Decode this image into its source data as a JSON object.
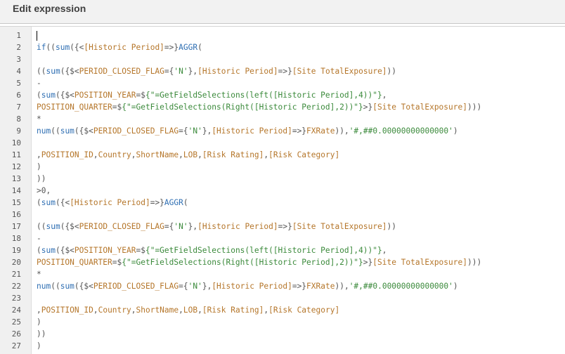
{
  "dialog": {
    "title": "Edit expression"
  },
  "editor": {
    "lines": [
      {
        "n": "1",
        "tokens": []
      },
      {
        "n": "2",
        "tokens": [
          [
            "k",
            "if"
          ],
          [
            "p",
            "(("
          ],
          [
            "k",
            "sum"
          ],
          [
            "p",
            "({<"
          ],
          [
            "f",
            "[Historic Period]"
          ],
          [
            "p",
            "=>}"
          ],
          [
            "k",
            "AGGR"
          ],
          [
            "p",
            "("
          ]
        ]
      },
      {
        "n": "3",
        "tokens": []
      },
      {
        "n": "4",
        "tokens": [
          [
            "p",
            "(("
          ],
          [
            "k",
            "sum"
          ],
          [
            "p",
            "({$<"
          ],
          [
            "f",
            "PERIOD_CLOSED_FLAG"
          ],
          [
            "p",
            "={"
          ],
          [
            "s",
            "'N'"
          ],
          [
            "p",
            "},"
          ],
          [
            "f",
            "[Historic Period]"
          ],
          [
            "p",
            "=>}"
          ],
          [
            "f",
            "[Site TotalExposure]"
          ],
          [
            "p",
            "))"
          ]
        ]
      },
      {
        "n": "5",
        "tokens": [
          [
            "p",
            "-"
          ]
        ]
      },
      {
        "n": "6",
        "tokens": [
          [
            "p",
            "("
          ],
          [
            "k",
            "sum"
          ],
          [
            "p",
            "({$<"
          ],
          [
            "f",
            "POSITION_YEAR"
          ],
          [
            "p",
            "=$"
          ],
          [
            "s",
            "{\"=GetFieldSelections(left([Historic Period],4))\"}"
          ],
          [
            "p",
            ","
          ]
        ]
      },
      {
        "n": "7",
        "tokens": [
          [
            "f",
            "POSITION_QUARTER"
          ],
          [
            "p",
            "=$"
          ],
          [
            "s",
            "{\"=GetFieldSelections(Right([Historic Period],2))\"}"
          ],
          [
            "p",
            ">}"
          ],
          [
            "f",
            "[Site TotalExposure]"
          ],
          [
            "p",
            ")))"
          ]
        ]
      },
      {
        "n": "8",
        "tokens": [
          [
            "p",
            "*"
          ]
        ]
      },
      {
        "n": "9",
        "tokens": [
          [
            "k",
            "num"
          ],
          [
            "p",
            "(("
          ],
          [
            "k",
            "sum"
          ],
          [
            "p",
            "({$<"
          ],
          [
            "f",
            "PERIOD_CLOSED_FLAG"
          ],
          [
            "p",
            "={"
          ],
          [
            "s",
            "'N'"
          ],
          [
            "p",
            "},"
          ],
          [
            "f",
            "[Historic Period]"
          ],
          [
            "p",
            "=>}"
          ],
          [
            "f",
            "FXRate"
          ],
          [
            "p",
            ")),"
          ],
          [
            "s",
            "'#,##0.00000000000000'"
          ],
          [
            "p",
            ")"
          ]
        ]
      },
      {
        "n": "10",
        "tokens": []
      },
      {
        "n": "11",
        "tokens": [
          [
            "p",
            ","
          ],
          [
            "f",
            "POSITION_ID"
          ],
          [
            "p",
            ","
          ],
          [
            "f",
            "Country"
          ],
          [
            "p",
            ","
          ],
          [
            "f",
            "ShortName"
          ],
          [
            "p",
            ","
          ],
          [
            "f",
            "LOB"
          ],
          [
            "p",
            ","
          ],
          [
            "f",
            "[Risk Rating]"
          ],
          [
            "p",
            ","
          ],
          [
            "f",
            "[Risk Category]"
          ]
        ]
      },
      {
        "n": "12",
        "tokens": [
          [
            "p",
            ")"
          ]
        ]
      },
      {
        "n": "13",
        "tokens": [
          [
            "p",
            "))"
          ]
        ]
      },
      {
        "n": "14",
        "tokens": [
          [
            "p",
            ">0,"
          ]
        ]
      },
      {
        "n": "15",
        "tokens": [
          [
            "p",
            "("
          ],
          [
            "k",
            "sum"
          ],
          [
            "p",
            "({<"
          ],
          [
            "f",
            "[Historic Period]"
          ],
          [
            "p",
            "=>}"
          ],
          [
            "k",
            "AGGR"
          ],
          [
            "p",
            "("
          ]
        ]
      },
      {
        "n": "16",
        "tokens": []
      },
      {
        "n": "17",
        "tokens": [
          [
            "p",
            "(("
          ],
          [
            "k",
            "sum"
          ],
          [
            "p",
            "({$<"
          ],
          [
            "f",
            "PERIOD_CLOSED_FLAG"
          ],
          [
            "p",
            "={"
          ],
          [
            "s",
            "'N'"
          ],
          [
            "p",
            "},"
          ],
          [
            "f",
            "[Historic Period]"
          ],
          [
            "p",
            "=>}"
          ],
          [
            "f",
            "[Site TotalExposure]"
          ],
          [
            "p",
            "))"
          ]
        ]
      },
      {
        "n": "18",
        "tokens": [
          [
            "p",
            "-"
          ]
        ]
      },
      {
        "n": "19",
        "tokens": [
          [
            "p",
            "("
          ],
          [
            "k",
            "sum"
          ],
          [
            "p",
            "({$<"
          ],
          [
            "f",
            "POSITION_YEAR"
          ],
          [
            "p",
            "=$"
          ],
          [
            "s",
            "{\"=GetFieldSelections(left([Historic Period],4))\"}"
          ],
          [
            "p",
            ","
          ]
        ]
      },
      {
        "n": "20",
        "tokens": [
          [
            "f",
            "POSITION_QUARTER"
          ],
          [
            "p",
            "=$"
          ],
          [
            "s",
            "{\"=GetFieldSelections(Right([Historic Period],2))\"}"
          ],
          [
            "p",
            ">}"
          ],
          [
            "f",
            "[Site TotalExposure]"
          ],
          [
            "p",
            ")))"
          ]
        ]
      },
      {
        "n": "21",
        "tokens": [
          [
            "p",
            "*"
          ]
        ]
      },
      {
        "n": "22",
        "tokens": [
          [
            "k",
            "num"
          ],
          [
            "p",
            "(("
          ],
          [
            "k",
            "sum"
          ],
          [
            "p",
            "({$<"
          ],
          [
            "f",
            "PERIOD_CLOSED_FLAG"
          ],
          [
            "p",
            "={"
          ],
          [
            "s",
            "'N'"
          ],
          [
            "p",
            "},"
          ],
          [
            "f",
            "[Historic Period]"
          ],
          [
            "p",
            "=>}"
          ],
          [
            "f",
            "FXRate"
          ],
          [
            "p",
            ")),"
          ],
          [
            "s",
            "'#,##0.00000000000000'"
          ],
          [
            "p",
            ")"
          ]
        ]
      },
      {
        "n": "23",
        "tokens": []
      },
      {
        "n": "24",
        "tokens": [
          [
            "p",
            ","
          ],
          [
            "f",
            "POSITION_ID"
          ],
          [
            "p",
            ","
          ],
          [
            "f",
            "Country"
          ],
          [
            "p",
            ","
          ],
          [
            "f",
            "ShortName"
          ],
          [
            "p",
            ","
          ],
          [
            "f",
            "LOB"
          ],
          [
            "p",
            ","
          ],
          [
            "f",
            "[Risk Rating]"
          ],
          [
            "p",
            ","
          ],
          [
            "f",
            "[Risk Category]"
          ]
        ]
      },
      {
        "n": "25",
        "tokens": [
          [
            "p",
            ")"
          ]
        ]
      },
      {
        "n": "26",
        "tokens": [
          [
            "p",
            "))"
          ]
        ]
      },
      {
        "n": "27",
        "tokens": [
          [
            "p",
            ")"
          ]
        ]
      }
    ]
  }
}
